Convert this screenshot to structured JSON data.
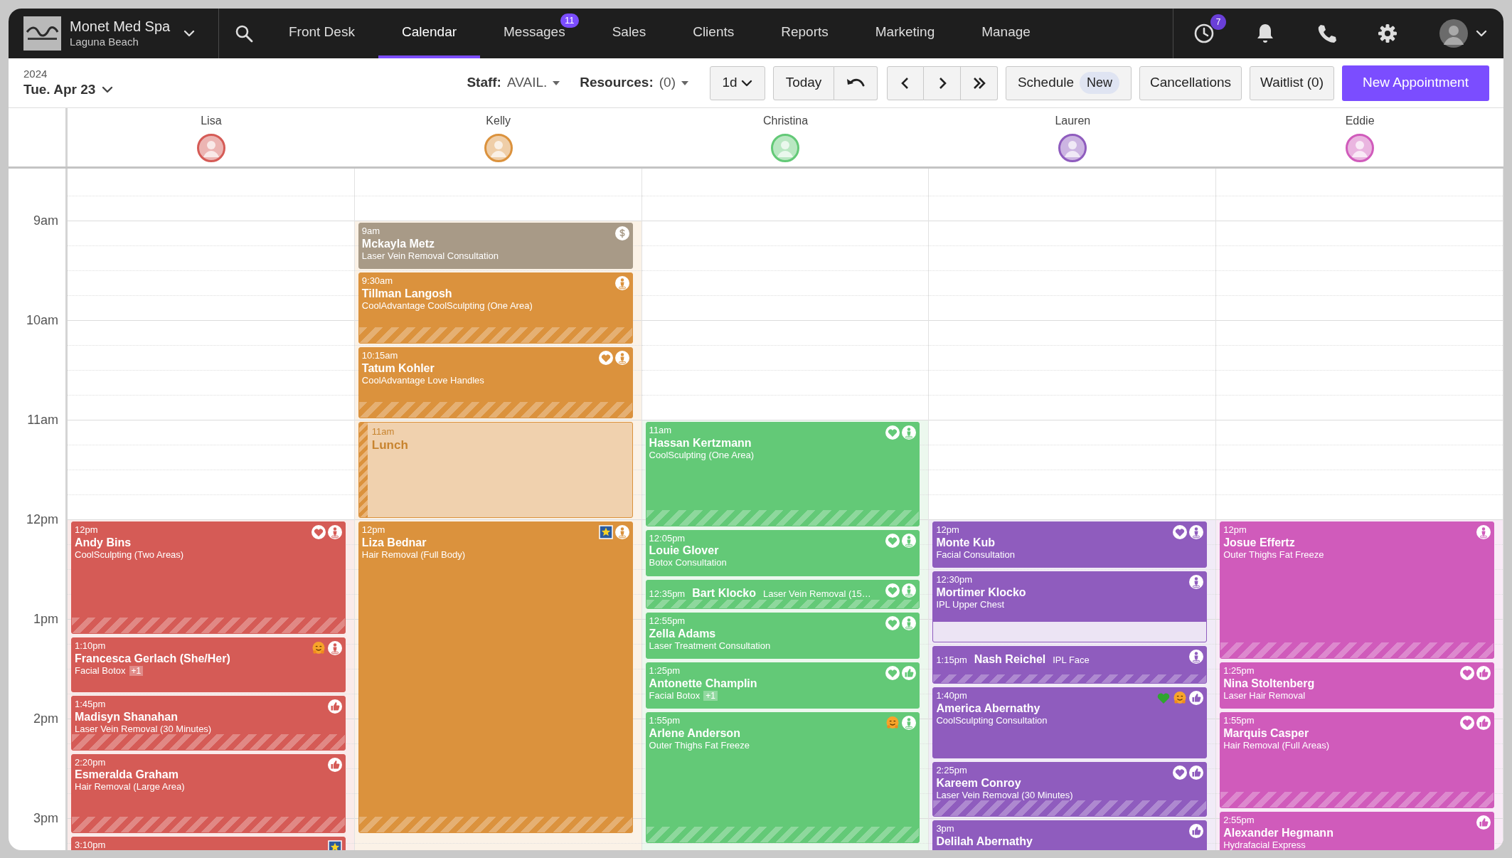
{
  "brand": {
    "business": "Monet Med Spa",
    "location": "Laguna Beach"
  },
  "nav": {
    "tabs": [
      {
        "label": "Front Desk",
        "selected": false
      },
      {
        "label": "Calendar",
        "selected": true
      },
      {
        "label": "Messages",
        "selected": false,
        "badge": "11"
      },
      {
        "label": "Sales",
        "selected": false
      },
      {
        "label": "Clients",
        "selected": false
      },
      {
        "label": "Reports",
        "selected": false
      },
      {
        "label": "Marketing",
        "selected": false
      },
      {
        "label": "Manage",
        "selected": false
      }
    ],
    "clock_badge": "7"
  },
  "toolbar": {
    "year": "2024",
    "date": "Tue. Apr 23",
    "staff_label": "Staff:",
    "staff_value": "AVAIL.",
    "resources_label": "Resources:",
    "resources_value": "(0)",
    "view": "1d",
    "today": "Today",
    "schedule": "Schedule",
    "schedule_badge": "New",
    "cancellations": "Cancellations",
    "waitlist": "Waitlist (0)",
    "new_appointment": "New Appointment"
  },
  "hours": [
    "9am",
    "10am",
    "11am",
    "12pm",
    "1pm",
    "2pm",
    "3pm"
  ],
  "staff": [
    {
      "name": "Lisa",
      "color": "#d55b56",
      "events": [
        {
          "kind": "appointment",
          "time": "12pm",
          "client": "Andy Bins",
          "service": "CoolSculpting (Two Areas)",
          "color": "#d55b56",
          "hatched": true,
          "unfilled_tail": false,
          "icons": [
            {
              "kind": "heart"
            },
            {
              "kind": "person"
            }
          ]
        },
        {
          "kind": "appointment",
          "time": "1:10pm",
          "client": "Francesca Gerlach (She/Her)",
          "service": "Facial Botox",
          "extra": "+1",
          "color": "#d55b56",
          "hatched": false,
          "unfilled_tail": false,
          "icons": [
            {
              "kind": "hug"
            },
            {
              "kind": "person"
            }
          ]
        },
        {
          "kind": "appointment",
          "time": "1:45pm",
          "client": "Madisyn Shanahan",
          "service": "Laser Vein Removal (30 Minutes)",
          "color": "#d55b56",
          "hatched": true,
          "unfilled_tail": false,
          "icons": [
            {
              "kind": "thumbs"
            }
          ]
        },
        {
          "kind": "appointment",
          "time": "2:20pm",
          "client": "Esmeralda Graham",
          "service": "Hair Removal (Large Area)",
          "color": "#d55b56",
          "hatched": true,
          "unfilled_tail": false,
          "icons": [
            {
              "kind": "thumbs"
            }
          ]
        },
        {
          "kind": "appointment",
          "time": "3:10pm",
          "color": "#d55b56",
          "icons": [
            {
              "kind": "star"
            }
          ]
        }
      ]
    },
    {
      "name": "Kelly",
      "color": "#db923d",
      "events": [
        {
          "kind": "appointment",
          "time": "9am",
          "client": "Mckayla Metz",
          "service": "Laser Vein Removal Consultation",
          "color": "#a89a87",
          "hatched": false,
          "unfilled_tail": false,
          "icons": [
            {
              "kind": "dollar"
            }
          ]
        },
        {
          "kind": "appointment",
          "time": "9:30am",
          "client": "Tillman Langosh",
          "service": "CoolAdvantage CoolSculpting (One Area)",
          "color": "#db923d",
          "hatched": true,
          "unfilled_tail": false,
          "icons": [
            {
              "kind": "person"
            }
          ]
        },
        {
          "kind": "appointment",
          "time": "10:15am",
          "client": "Tatum Kohler",
          "service": "CoolAdvantage Love Handles",
          "color": "#db923d",
          "hatched": true,
          "unfilled_tail": false,
          "icons": [
            {
              "kind": "heart"
            },
            {
              "kind": "person"
            }
          ]
        },
        {
          "kind": "break",
          "time": "11am",
          "client": "Lunch",
          "color": "#db923d"
        },
        {
          "kind": "appointment",
          "time": "12pm",
          "client": "Liza Bednar",
          "service": "Hair Removal (Full Body)",
          "color": "#db923d",
          "hatched": true,
          "unfilled_tail": false,
          "icons": [
            {
              "kind": "star"
            },
            {
              "kind": "person"
            }
          ]
        }
      ]
    },
    {
      "name": "Christina",
      "color": "#63c977",
      "events": [
        {
          "kind": "appointment",
          "time": "11am",
          "client": "Hassan Kertzmann",
          "service": "CoolSculpting (One Area)",
          "color": "#63c977",
          "hatched": true,
          "unfilled_tail": false,
          "icons": [
            {
              "kind": "heart"
            },
            {
              "kind": "person"
            }
          ]
        },
        {
          "kind": "appointment",
          "time": "12:05pm",
          "client": "Louie Glover",
          "service": "Botox Consultation",
          "color": "#63c977",
          "hatched": false,
          "unfilled_tail": false,
          "icons": [
            {
              "kind": "heart"
            },
            {
              "kind": "person"
            }
          ]
        },
        {
          "kind": "appointment",
          "time": "12:35pm",
          "client": "Bart Klocko",
          "service": "Laser Vein Removal (15…",
          "color": "#63c977",
          "hatched": true,
          "unfilled_tail": false,
          "icons": [
            {
              "kind": "heart"
            },
            {
              "kind": "person"
            }
          ]
        },
        {
          "kind": "appointment",
          "time": "12:55pm",
          "client": "Zella Adams",
          "service": "Laser Treatment Consultation",
          "color": "#63c977",
          "hatched": false,
          "unfilled_tail": false,
          "icons": [
            {
              "kind": "heart"
            },
            {
              "kind": "person"
            }
          ]
        },
        {
          "kind": "appointment",
          "time": "1:25pm",
          "client": "Antonette Champlin",
          "service": "Facial Botox",
          "extra": "+1",
          "color": "#63c977",
          "hatched": false,
          "unfilled_tail": false,
          "icons": [
            {
              "kind": "heart"
            },
            {
              "kind": "thumbs"
            }
          ]
        },
        {
          "kind": "appointment",
          "time": "1:55pm",
          "client": "Arlene Anderson",
          "service": "Outer Thighs Fat Freeze",
          "color": "#63c977",
          "hatched": true,
          "unfilled_tail": false,
          "icons": [
            {
              "kind": "hug"
            },
            {
              "kind": "person"
            }
          ]
        }
      ]
    },
    {
      "name": "Lauren",
      "color": "#8f5cbe",
      "events": [
        {
          "kind": "appointment",
          "time": "12pm",
          "client": "Monte Kub",
          "service": "Facial Consultation",
          "color": "#8f5cbe",
          "hatched": false,
          "unfilled_tail": false,
          "icons": [
            {
              "kind": "heart"
            },
            {
              "kind": "person"
            }
          ]
        },
        {
          "kind": "appointment",
          "time": "12:30pm",
          "client": "Mortimer Klocko",
          "service": "IPL Upper Chest",
          "color": "#8f5cbe",
          "hatched": false,
          "unfilled_tail": true,
          "icons": [
            {
              "kind": "person"
            }
          ]
        },
        {
          "kind": "appointment",
          "time": "1:15pm",
          "client": "Nash Reichel",
          "service": "IPL Face",
          "color": "#8f5cbe",
          "hatched": true,
          "unfilled_tail": false,
          "icons": [
            {
              "kind": "person"
            }
          ]
        },
        {
          "kind": "appointment",
          "time": "1:40pm",
          "client": "America Abernathy",
          "service": "CoolSculpting Consultation",
          "color": "#8f5cbe",
          "hatched": false,
          "unfilled_tail": false,
          "icons": [
            {
              "kind": "green_heart"
            },
            {
              "kind": "hug"
            },
            {
              "kind": "thumbs"
            }
          ]
        },
        {
          "kind": "appointment",
          "time": "2:25pm",
          "client": "Kareem Conroy",
          "service": "Laser Vein Removal (30 Minutes)",
          "color": "#8f5cbe",
          "hatched": true,
          "unfilled_tail": false,
          "icons": [
            {
              "kind": "heart"
            },
            {
              "kind": "thumbs"
            }
          ]
        },
        {
          "kind": "appointment",
          "time": "3pm",
          "client": "Delilah Abernathy",
          "color": "#8f5cbe",
          "icons": [
            {
              "kind": "thumbs"
            }
          ]
        }
      ]
    },
    {
      "name": "Eddie",
      "color": "#d05bbb",
      "events": [
        {
          "kind": "appointment",
          "time": "12pm",
          "client": "Josue Effertz",
          "service": "Outer Thighs Fat Freeze",
          "color": "#d05bbb",
          "hatched": true,
          "unfilled_tail": false,
          "icons": [
            {
              "kind": "person"
            }
          ]
        },
        {
          "kind": "appointment",
          "time": "1:25pm",
          "client": "Nina Stoltenberg",
          "service": "Laser Hair Removal",
          "color": "#d05bbb",
          "hatched": false,
          "unfilled_tail": false,
          "icons": [
            {
              "kind": "heart"
            },
            {
              "kind": "thumbs"
            }
          ]
        },
        {
          "kind": "appointment",
          "time": "1:55pm",
          "client": "Marquis Casper",
          "service": "Hair Removal (Full Areas)",
          "color": "#d05bbb",
          "hatched": true,
          "unfilled_tail": false,
          "icons": [
            {
              "kind": "heart"
            },
            {
              "kind": "thumbs"
            }
          ]
        },
        {
          "kind": "appointment",
          "time": "2:55pm",
          "client": "Alexander Hegmann",
          "service": "Hydrafacial Express",
          "color": "#d05bbb",
          "icons": [
            {
              "kind": "thumbs"
            }
          ]
        }
      ]
    }
  ]
}
